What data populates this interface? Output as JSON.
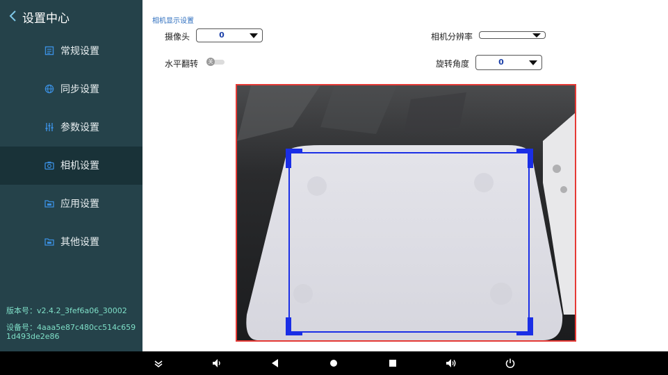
{
  "sidebar": {
    "title": "设置中心",
    "items": [
      {
        "label": "常规设置",
        "icon": "edit-icon"
      },
      {
        "label": "同步设置",
        "icon": "globe-icon"
      },
      {
        "label": "参数设置",
        "icon": "sliders-icon"
      },
      {
        "label": "相机设置",
        "icon": "camera-icon",
        "active": true
      },
      {
        "label": "应用设置",
        "icon": "folder-icon"
      },
      {
        "label": "其他设置",
        "icon": "folder-icon"
      }
    ],
    "version": "版本号：v2.4.2_3fef6a06_30002",
    "device": "设备号：4aaa5e87c480cc514c6591d493de2e86"
  },
  "main": {
    "section_title": "相机显示设置",
    "camera_label": "摄像头",
    "camera_value": "0",
    "resolution_label": "相机分辨率",
    "resolution_value": "",
    "flip_label": "水平翻转",
    "flip_state": "关",
    "rotate_label": "旋转角度",
    "rotate_value": "0"
  },
  "colors": {
    "sidebar_bg": "#25424a",
    "sidebar_active": "#193238",
    "accent_blue": "#2f6fbf",
    "version_text": "#7fe0c8",
    "preview_border": "#e53935",
    "roi_box": "#1a2ee6"
  },
  "navbar": {
    "icons": [
      "collapse-icon",
      "volume-down-icon",
      "back-icon",
      "home-icon",
      "recents-icon",
      "volume-up-icon",
      "power-icon"
    ]
  }
}
